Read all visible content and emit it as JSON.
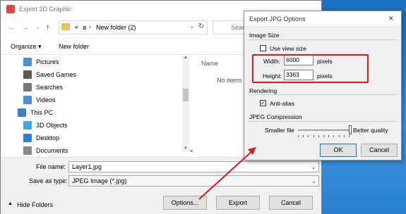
{
  "main_dialog": {
    "title": "Export 2D Graphic",
    "address": {
      "breadcrumb_prefix": "«",
      "drive": "a",
      "sep": "›",
      "folder": "New folder (2)"
    },
    "search_placeholder": "Search",
    "toolbar": {
      "organize": "Organize ▾",
      "new_folder": "New folder"
    },
    "sidebar": [
      {
        "label": "Pictures",
        "icon": "pictures-icon",
        "color": "#4a8fd8"
      },
      {
        "label": "Saved Games",
        "icon": "saved-games-icon",
        "color": "#5a5a5a"
      },
      {
        "label": "Searches",
        "icon": "search-icon",
        "color": "#777777"
      },
      {
        "label": "Videos",
        "icon": "videos-icon",
        "color": "#4a8fd8"
      },
      {
        "label": "This PC",
        "icon": "computer-icon",
        "color": "#3a7fd0"
      },
      {
        "label": "3D Objects",
        "icon": "3d-objects-icon",
        "color": "#3aa8e8"
      },
      {
        "label": "Desktop",
        "icon": "desktop-icon",
        "color": "#2b7fd4"
      },
      {
        "label": "Documents",
        "icon": "documents-icon",
        "color": "#8a8a8a"
      }
    ],
    "list": {
      "column_name": "Name",
      "empty_text": "No items m"
    },
    "file_name_label": "File name:",
    "file_name_value": "Layer1.jpg",
    "save_type_label": "Save as type:",
    "save_type_value": "JPEG Image (*.jpg)",
    "hide_folders": "Hide Folders",
    "buttons": {
      "options": "Options...",
      "export": "Export",
      "cancel": "Cancel"
    }
  },
  "options_dialog": {
    "title": "Export JPG Options",
    "close": "✕",
    "image_size": {
      "section": "Image Size",
      "use_view_size": "Use view size",
      "use_view_size_checked": false,
      "width_label": "Width:",
      "width_value": "6000",
      "height_label": "Height:",
      "height_value": "3363",
      "unit": "pixels"
    },
    "rendering": {
      "section": "Rendering",
      "anti_alias": "Anti-alias",
      "anti_alias_checked": true,
      "check_mark": "✓"
    },
    "jpeg": {
      "section": "JPEG Compression",
      "smaller": "Smaller file",
      "better": "Better quality",
      "slider_value": 1.0
    },
    "buttons": {
      "ok": "OK",
      "cancel": "Cancel"
    }
  },
  "colors": {
    "annotation_red": "#e3141b",
    "desktop_blue": "#2a7fd0"
  }
}
